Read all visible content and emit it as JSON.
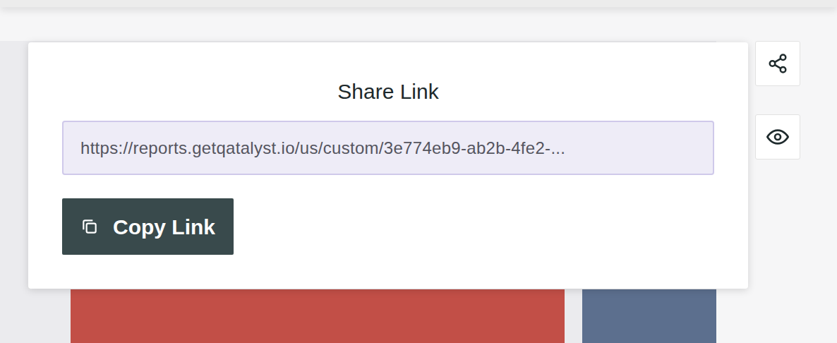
{
  "popover": {
    "title": "Share Link",
    "link_field": {
      "value": "https://reports.getqatalyst.io/us/custom/3e774eb9-ab2b-4fe2-..."
    },
    "copy_button": {
      "label": "Copy Link"
    }
  }
}
